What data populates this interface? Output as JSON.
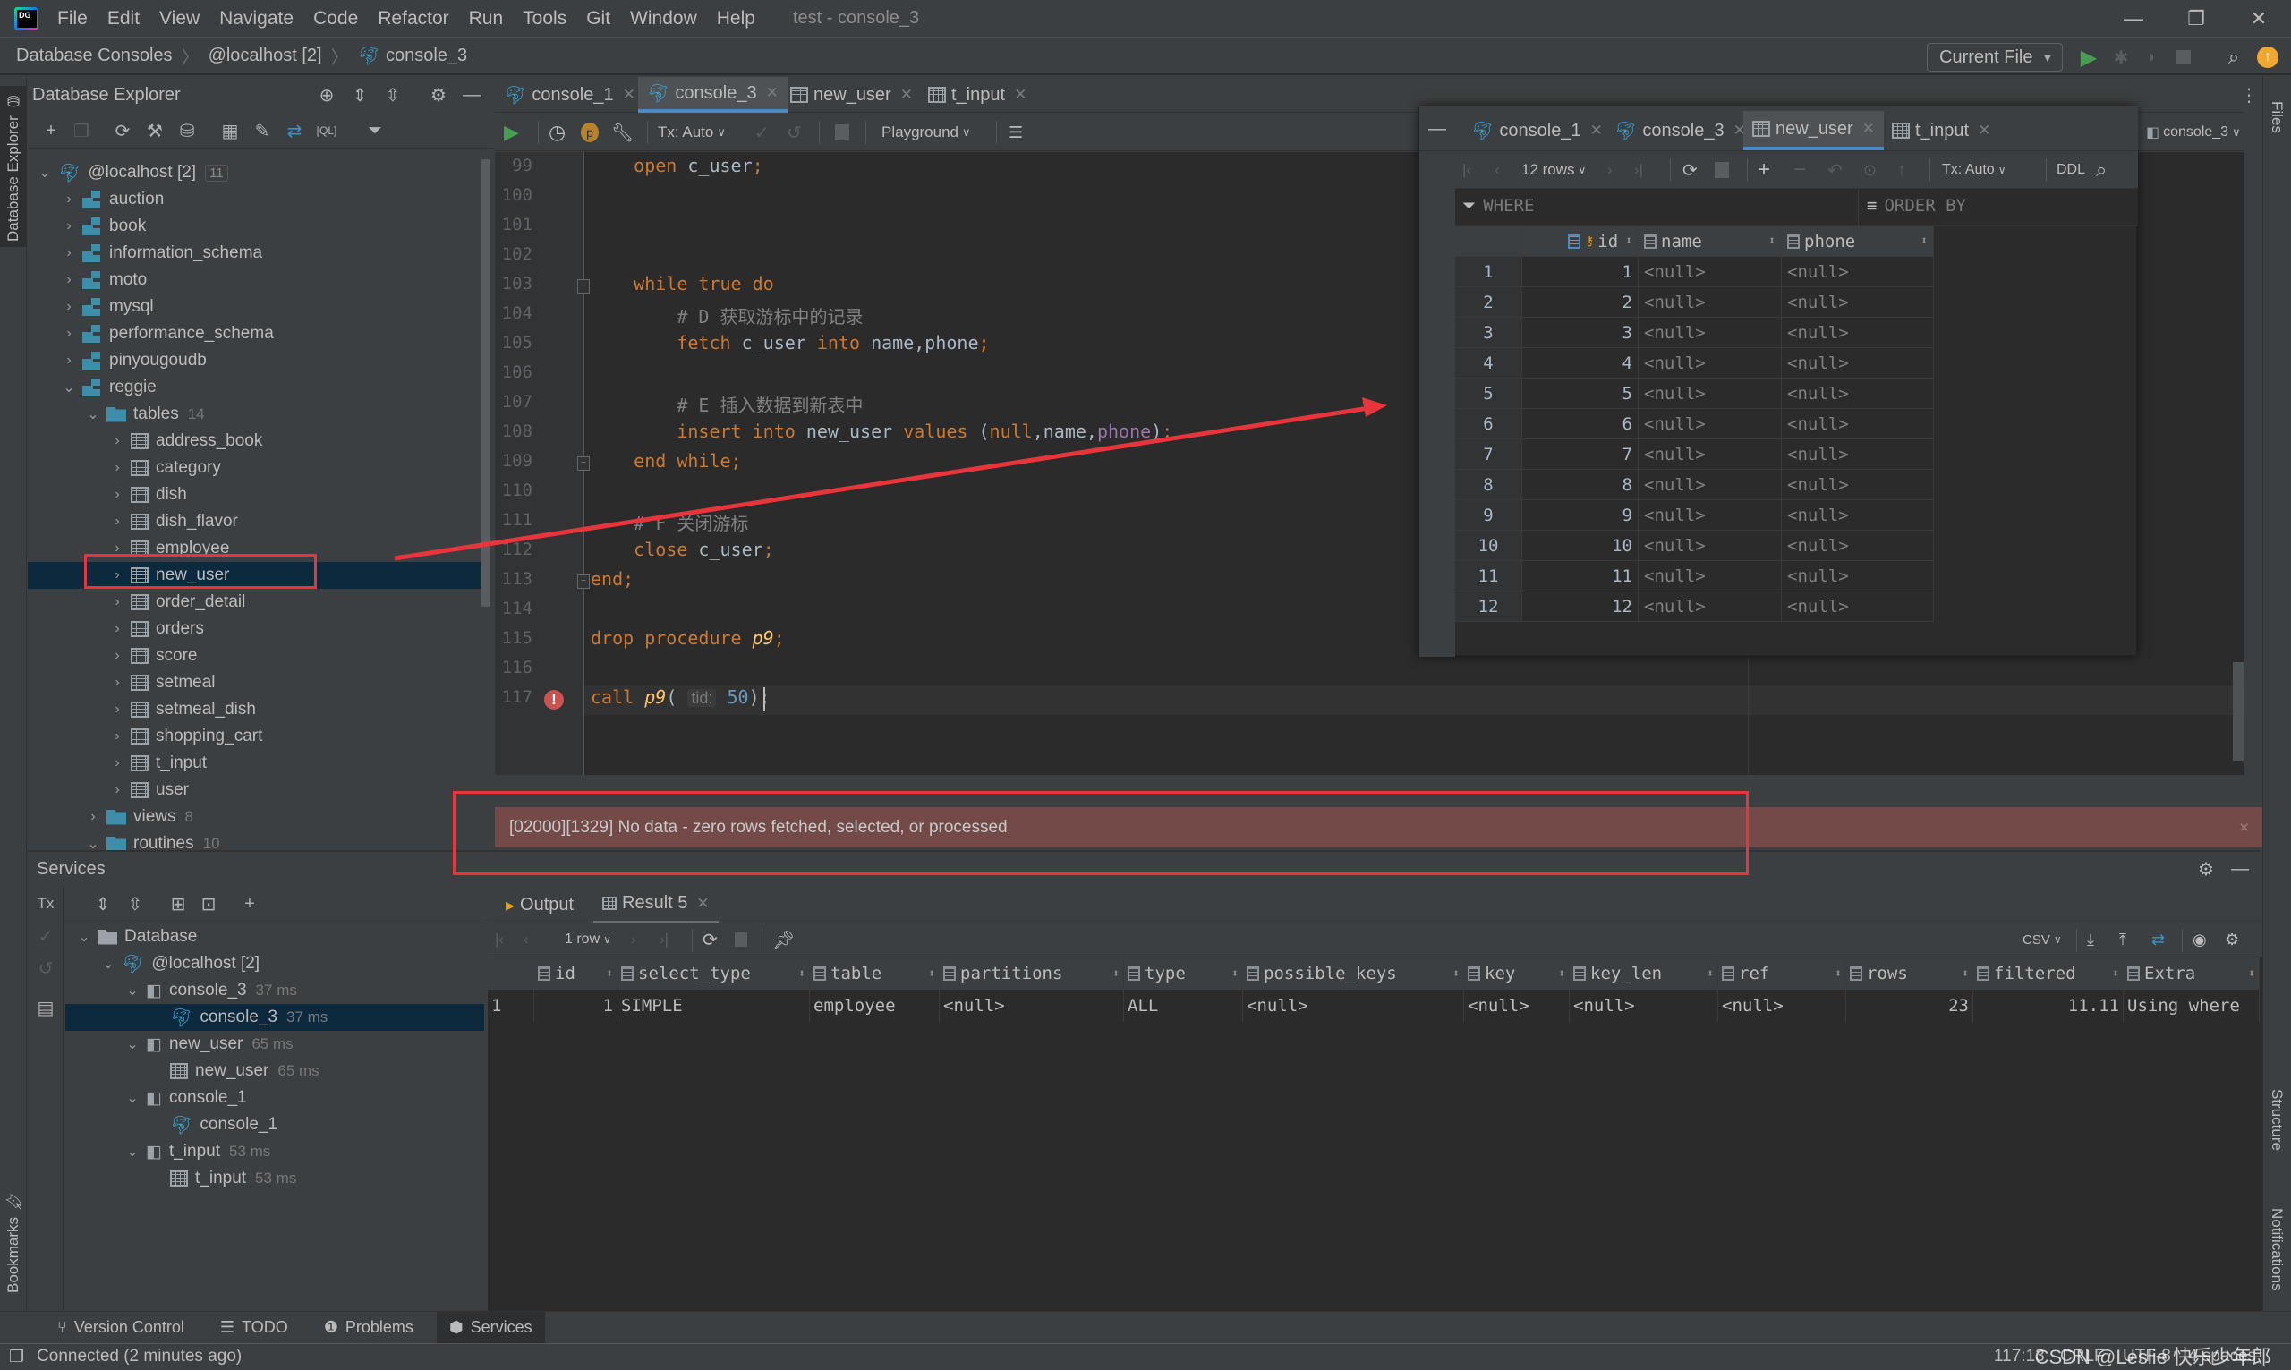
{
  "menubar": {
    "items": [
      "File",
      "Edit",
      "View",
      "Navigate",
      "Code",
      "Refactor",
      "Run",
      "Tools",
      "Git",
      "Window",
      "Help"
    ],
    "window_title": "test - console_3"
  },
  "navbar": {
    "breadcrumb": [
      "Database Consoles",
      "@localhost [2]",
      "console_3"
    ],
    "run_config": "Current File"
  },
  "db_explorer": {
    "title": "Database Explorer",
    "root": {
      "label": "@localhost [2]",
      "count": "11"
    },
    "schemas": [
      "auction",
      "book",
      "information_schema",
      "moto",
      "mysql",
      "performance_schema",
      "pinyougoudb",
      "reggie"
    ],
    "tables_folder": {
      "label": "tables",
      "count": "14"
    },
    "tables": [
      "address_book",
      "category",
      "dish",
      "dish_flavor",
      "employee",
      "new_user",
      "order_detail",
      "orders",
      "score",
      "setmeal",
      "setmeal_dish",
      "shopping_cart",
      "t_input",
      "user"
    ],
    "selected_table": "new_user",
    "views_folder": {
      "label": "views",
      "count": "8"
    },
    "routines_folder": {
      "label": "routines",
      "count": "10"
    }
  },
  "editor_tabs": [
    {
      "label": "console_1",
      "icon": "mysql-console-icon",
      "active": false
    },
    {
      "label": "console_3",
      "icon": "mysql-console-icon",
      "active": true
    },
    {
      "label": "new_user",
      "icon": "table-icon",
      "active": false
    },
    {
      "label": "t_input",
      "icon": "table-icon",
      "active": false
    }
  ],
  "editor_toolbar": {
    "tx_mode": "Tx: Auto",
    "playground": "Playground",
    "session": "console_3"
  },
  "editor": {
    "lines": [
      {
        "n": "99",
        "html": "    <span class='kw'>open</span> c_user<span class='kw'>;</span>"
      },
      {
        "n": "100",
        "html": ""
      },
      {
        "n": "101",
        "html": ""
      },
      {
        "n": "102",
        "html": ""
      },
      {
        "n": "103",
        "html": "    <span class='kw'>while true do</span>"
      },
      {
        "n": "104",
        "html": "        <span class='cmt'># D 获取游标中的记录</span>"
      },
      {
        "n": "105",
        "html": "        <span class='kw'>fetch</span> c_user <span class='kw'>into</span> name,phone<span class='kw'>;</span>"
      },
      {
        "n": "106",
        "html": ""
      },
      {
        "n": "107",
        "html": "        <span class='cmt'># E 插入数据到新表中</span>"
      },
      {
        "n": "108",
        "html": "        <span class='kw'>insert into</span> new_user <span class='kw'>values</span> (<span class='kw'>null</span>,name,<span class='var'>phone</span>)<span class='kw'>;</span>"
      },
      {
        "n": "109",
        "html": "    <span class='kw'>end while;</span>"
      },
      {
        "n": "110",
        "html": ""
      },
      {
        "n": "111",
        "html": "    <span class='cmt'># F 关闭游标</span>"
      },
      {
        "n": "112",
        "html": "    <span class='kw'>close</span> c_user<span class='kw'>;</span>"
      },
      {
        "n": "113",
        "html": "<span class='kw'>end;</span>"
      },
      {
        "n": "114",
        "html": ""
      },
      {
        "n": "115",
        "html": "<span class='kw'>drop procedure</span> <span class='fn'>p9</span><span class='kw'>;</span>"
      },
      {
        "n": "116",
        "html": ""
      },
      {
        "n": "117",
        "html": "<span class='kw'>call</span> <span class='fn'>p9</span>( <span class='hint'>tid:</span> <span class='num'>50</span>)<span class='kw'>;</span>"
      }
    ]
  },
  "popup": {
    "tabs": [
      "console_1",
      "console_3",
      "new_user",
      "t_input"
    ],
    "active_tab": "new_user",
    "rows_label": "12 rows",
    "tx_mode": "Tx: Auto",
    "ddl_label": "DDL",
    "where_label": "WHERE",
    "order_by_label": "ORDER BY",
    "columns": [
      "id",
      "name",
      "phone"
    ],
    "rows": [
      [
        "1",
        "<null>",
        "<null>"
      ],
      [
        "2",
        "<null>",
        "<null>"
      ],
      [
        "3",
        "<null>",
        "<null>"
      ],
      [
        "4",
        "<null>",
        "<null>"
      ],
      [
        "5",
        "<null>",
        "<null>"
      ],
      [
        "6",
        "<null>",
        "<null>"
      ],
      [
        "7",
        "<null>",
        "<null>"
      ],
      [
        "8",
        "<null>",
        "<null>"
      ],
      [
        "9",
        "<null>",
        "<null>"
      ],
      [
        "10",
        "<null>",
        "<null>"
      ],
      [
        "11",
        "<null>",
        "<null>"
      ],
      [
        "12",
        "<null>",
        "<null>"
      ]
    ]
  },
  "error_banner": "[02000][1329] No data - zero rows fetched, selected, or processed",
  "services": {
    "title": "Services",
    "tree": [
      {
        "label": "Database",
        "time": "",
        "level": 0,
        "icon": "folder-icon"
      },
      {
        "label": "@localhost [2]",
        "time": "",
        "level": 1,
        "icon": "mysql-icon"
      },
      {
        "label": "console_3",
        "time": "37 ms",
        "level": 2,
        "icon": "session-icon"
      },
      {
        "label": "console_3",
        "time": "37 ms",
        "level": 3,
        "icon": "mysql-console-icon",
        "selected": true
      },
      {
        "label": "new_user",
        "time": "65 ms",
        "level": 2,
        "icon": "session-icon"
      },
      {
        "label": "new_user",
        "time": "65 ms",
        "level": 3,
        "icon": "table-icon"
      },
      {
        "label": "console_1",
        "time": "",
        "level": 2,
        "icon": "session-icon"
      },
      {
        "label": "console_1",
        "time": "",
        "level": 3,
        "icon": "mysql-console-icon"
      },
      {
        "label": "t_input",
        "time": "53 ms",
        "level": 2,
        "icon": "session-icon"
      },
      {
        "label": "t_input",
        "time": "53 ms",
        "level": 3,
        "icon": "table-icon"
      }
    ],
    "result_tabs": [
      "Output",
      "Result 5"
    ],
    "rows_label": "1 row",
    "export_format": "CSV",
    "columns": [
      "id",
      "select_type",
      "table",
      "partitions",
      "type",
      "possible_keys",
      "key",
      "key_len",
      "ref",
      "rows",
      "filtered",
      "Extra"
    ],
    "rows": [
      [
        "1",
        "SIMPLE",
        "employee",
        "<null>",
        "ALL",
        "<null>",
        "<null>",
        "<null>",
        "<null>",
        "23",
        "11.11",
        "Using where"
      ]
    ]
  },
  "bottom_tabs": [
    "Version Control",
    "TODO",
    "Problems",
    "Services"
  ],
  "active_bottom_tab": "Services",
  "left_stripe": [
    "Database Explorer",
    "Bookmarks"
  ],
  "right_stripe": [
    "Files",
    "Structure",
    "Notifications"
  ],
  "statusbar": {
    "message": "Connected (2 minutes ago)",
    "position": "117:13",
    "line_sep": "CRLF",
    "encoding": "UTF-8",
    "indent": "4 spaces",
    "watermark": "CSDN @Leslie 快乐少年郎"
  },
  "colors": {
    "accent": "#4a88c7",
    "error_banner": "#734a47",
    "annotation_red": "#e8353b",
    "selection": "#0d293e"
  }
}
